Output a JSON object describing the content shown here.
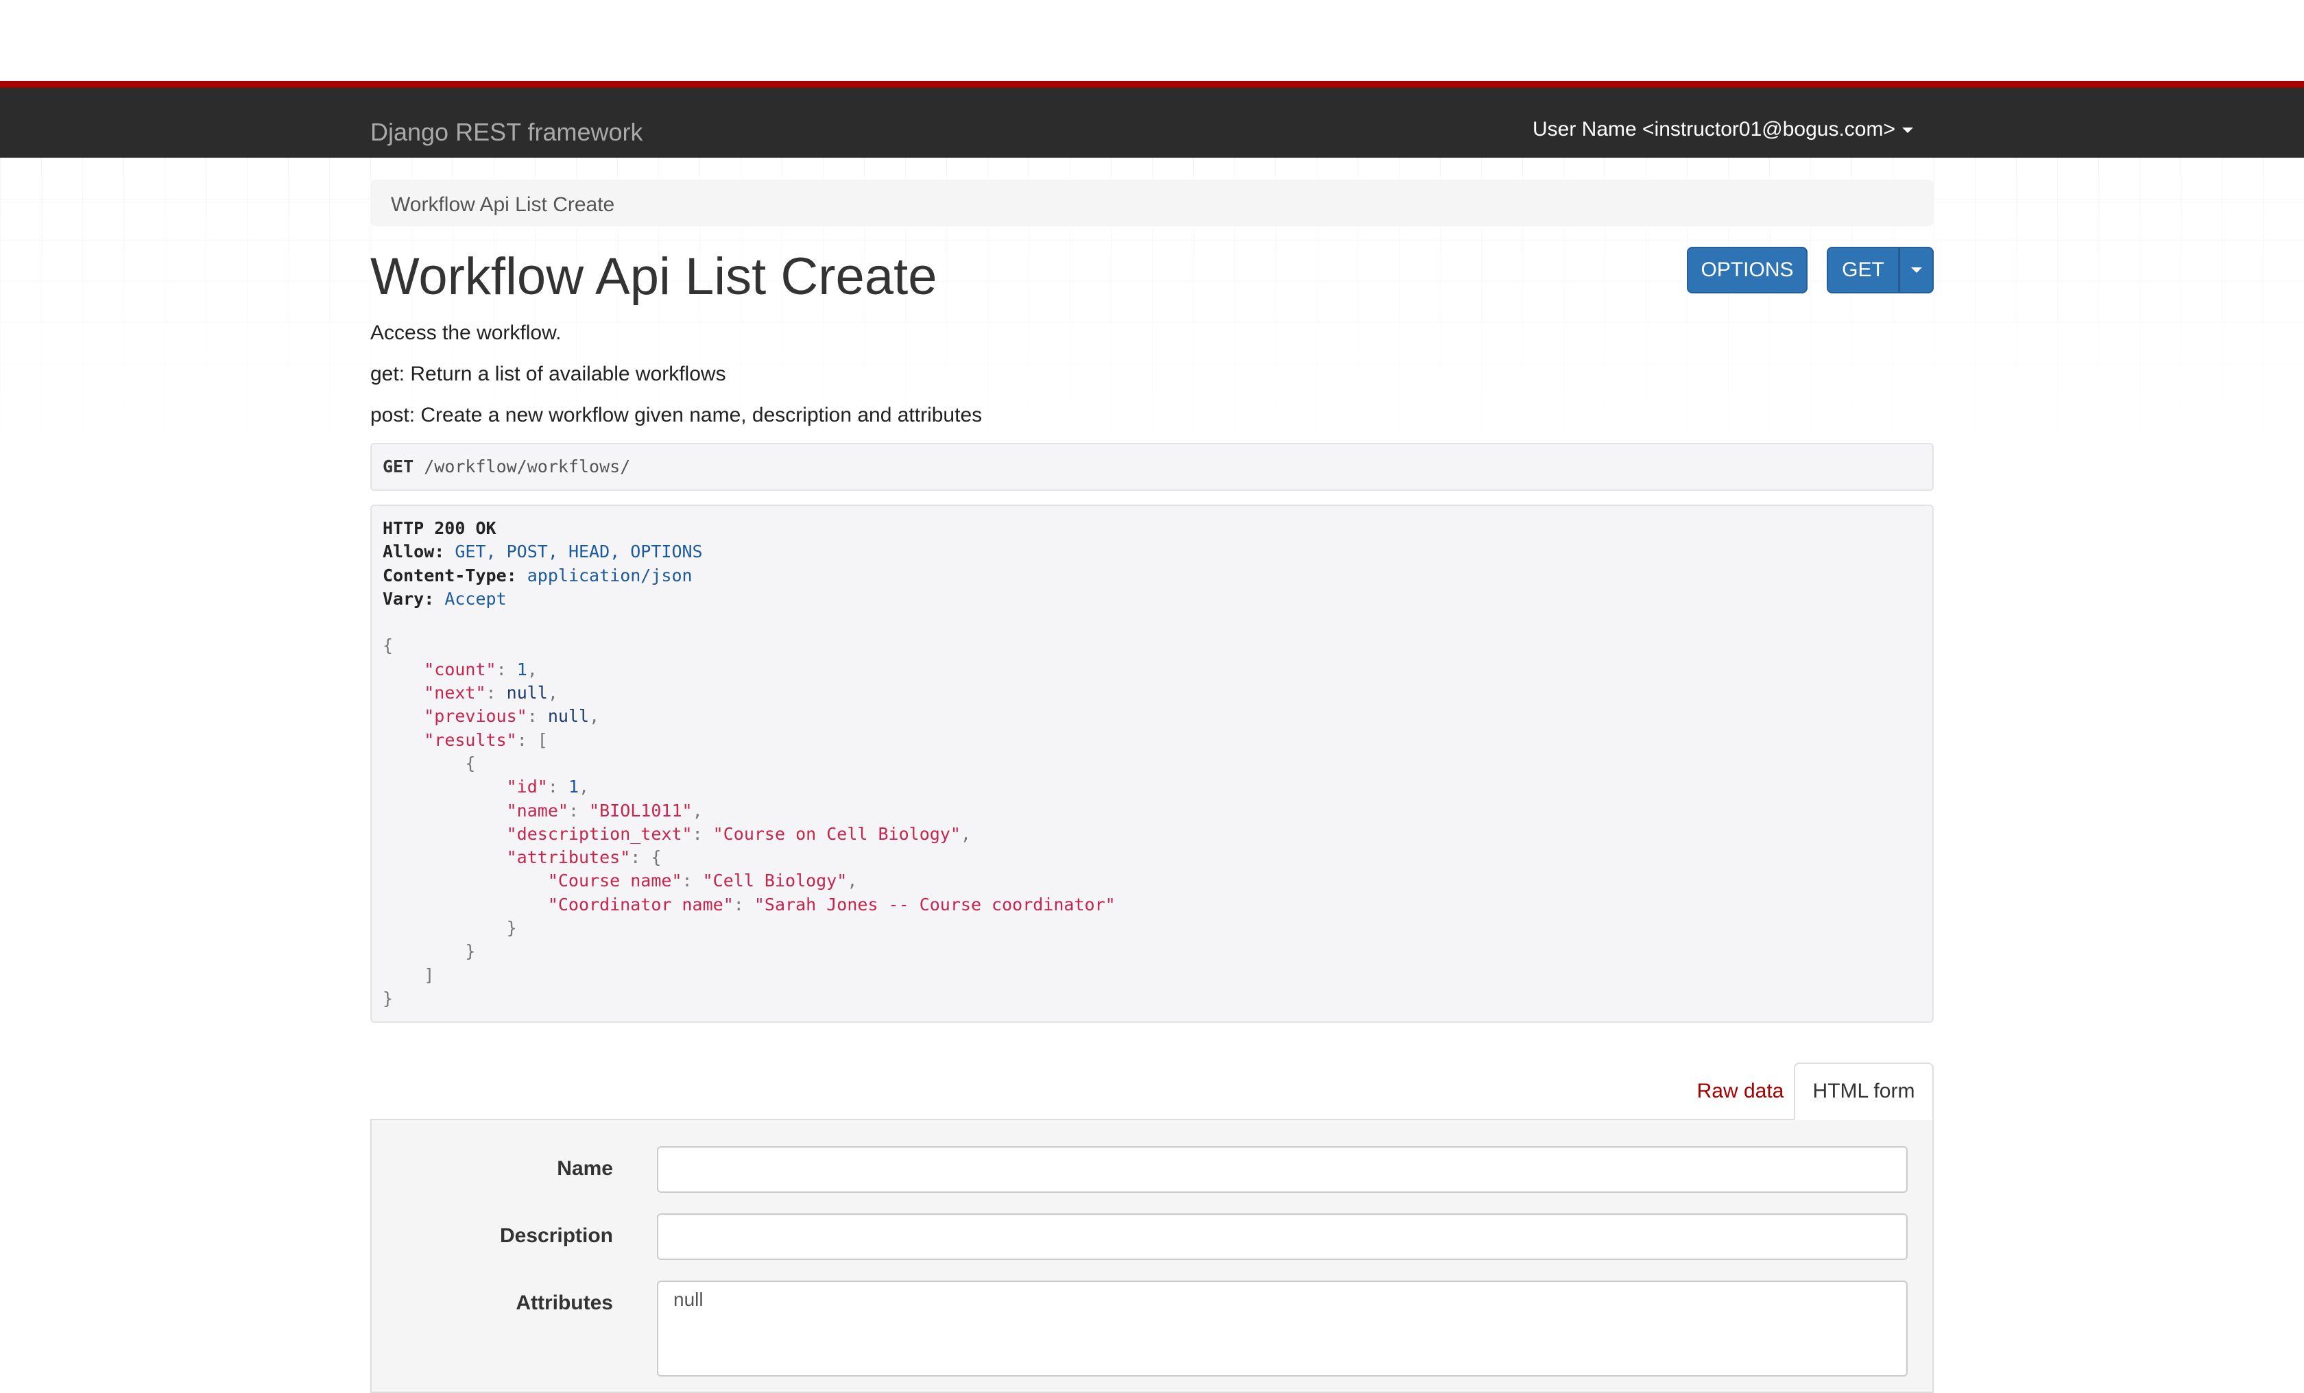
{
  "navbar": {
    "brand": "Django REST framework",
    "user_menu": "User Name <instructor01@bogus.com>"
  },
  "breadcrumb": "Workflow Api List Create",
  "page": {
    "title": "Workflow Api List Create",
    "options_button": "OPTIONS",
    "get_button": "GET",
    "descriptions": [
      "Access the workflow.",
      "get: Return a list of available workflows",
      "post: Create a new workflow given name, description and attributes"
    ]
  },
  "request": {
    "method": "GET",
    "path": "/workflow/workflows/"
  },
  "response": {
    "status": "HTTP 200 OK",
    "headers": [
      {
        "key": "Allow:",
        "value": "GET, POST, HEAD, OPTIONS"
      },
      {
        "key": "Content-Type:",
        "value": "application/json"
      },
      {
        "key": "Vary:",
        "value": "Accept"
      }
    ],
    "body": {
      "count_key": "\"count\"",
      "count_val": "1",
      "next_key": "\"next\"",
      "next_val": "null",
      "previous_key": "\"previous\"",
      "previous_val": "null",
      "results_key": "\"results\"",
      "id_key": "\"id\"",
      "id_val": "1",
      "name_key": "\"name\"",
      "name_val": "\"BIOL1011\"",
      "desc_key": "\"description_text\"",
      "desc_val": "\"Course on Cell Biology\"",
      "attributes_key": "\"attributes\"",
      "course_name_key": "\"Course name\"",
      "course_name_val": "\"Cell Biology\"",
      "coordinator_key": "\"Coordinator name\"",
      "coordinator_val": "\"Sarah Jones -- Course coordinator\""
    }
  },
  "form_tabs": {
    "raw": "Raw data",
    "html": "HTML form"
  },
  "form": {
    "name_label": "Name",
    "name_value": "",
    "description_label": "Description",
    "description_value": "",
    "attributes_label": "Attributes",
    "attributes_value": "null"
  },
  "colors": {
    "accent_red": "#a30000",
    "navbar_bg": "#2c2c2c",
    "button_blue": "#2e74b5"
  }
}
